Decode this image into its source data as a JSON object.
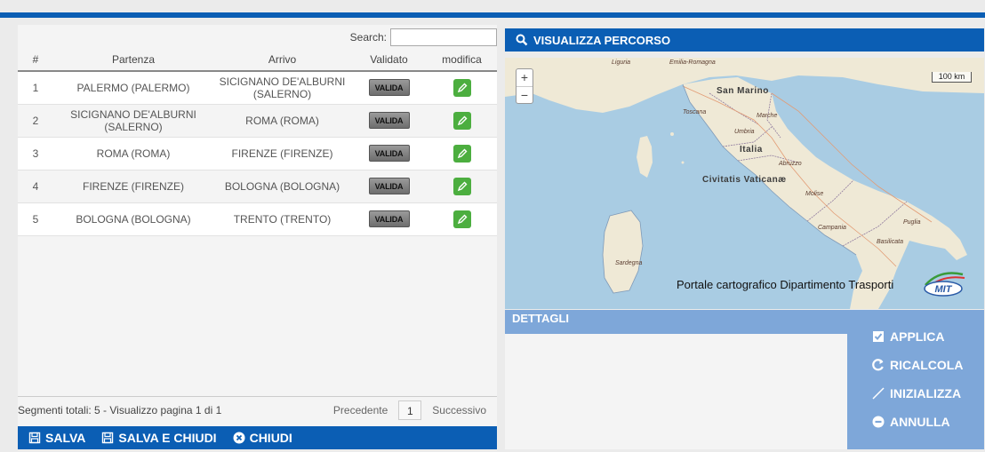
{
  "search": {
    "label": "Search:",
    "value": ""
  },
  "table": {
    "headers": [
      "#",
      "Partenza",
      "Arrivo",
      "Validato",
      "modifica"
    ],
    "rows": [
      {
        "num": "1",
        "partenza": "PALERMO (PALERMO)",
        "arrivo": "SICIGNANO DE'ALBURNI (SALERNO)",
        "validato": "VALIDA"
      },
      {
        "num": "2",
        "partenza": "SICIGNANO DE'ALBURNI (SALERNO)",
        "arrivo": "ROMA (ROMA)",
        "validato": "VALIDA"
      },
      {
        "num": "3",
        "partenza": "ROMA (ROMA)",
        "arrivo": "FIRENZE (FIRENZE)",
        "validato": "VALIDA"
      },
      {
        "num": "4",
        "partenza": "FIRENZE (FIRENZE)",
        "arrivo": "BOLOGNA (BOLOGNA)",
        "validato": "VALIDA"
      },
      {
        "num": "5",
        "partenza": "BOLOGNA (BOLOGNA)",
        "arrivo": "TRENTO (TRENTO)",
        "validato": "VALIDA"
      }
    ]
  },
  "footer": {
    "info": "Segmenti totali: 5 - Visualizzo pagina 1 di 1",
    "prev": "Precedente",
    "page": "1",
    "next": "Successivo"
  },
  "actions": {
    "salva": "SALVA",
    "salva_chiudi": "SALVA E CHIUDI",
    "chiudi": "CHIUDI"
  },
  "map": {
    "header": "VISUALIZZA PERCORSO",
    "zoom_in": "+",
    "zoom_out": "−",
    "scale": "100 km",
    "caption": "Portale cartografico Dipartimento Trasporti",
    "logo": "MIT",
    "places": {
      "liguria": "Liguria",
      "emilia": "Emilia-Romagna",
      "sanmarino": "San Marino",
      "toscana": "Toscana",
      "marche": "Marche",
      "umbria": "Umbria",
      "italia": "Italia",
      "abruzzo": "Abruzzo",
      "vaticano": "Civitatis Vaticanæ",
      "molise": "Molise",
      "campania": "Campania",
      "puglia": "Puglia",
      "basilicata": "Basilicata",
      "sardegna": "Sardegna"
    }
  },
  "details": {
    "title": "DETTAGLI"
  },
  "side_actions": {
    "applica": "APPLICA",
    "ricalcola": "RICALCOLA",
    "inizializza": "INIZIALIZZA",
    "annulla": "ANNULLA"
  },
  "colors": {
    "primary": "#0b5eb4",
    "secondary": "#7ea7d9",
    "edit": "#4cae3f"
  }
}
